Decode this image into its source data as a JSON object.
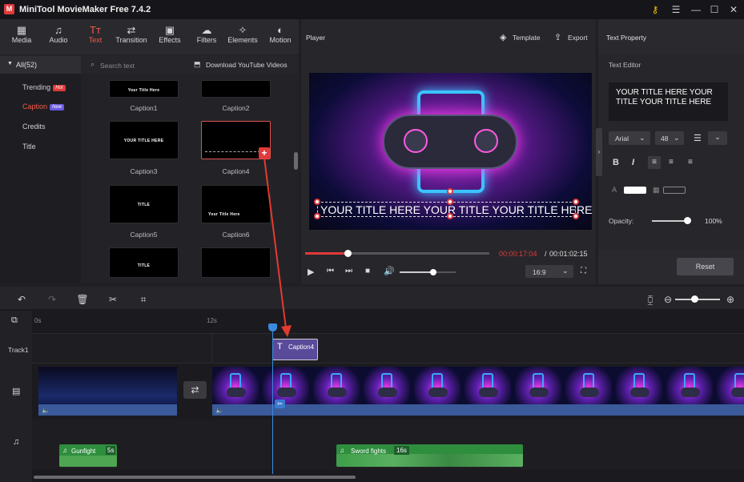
{
  "app": {
    "title": "MiniTool MovieMaker Free 7.4.2",
    "logo": "M"
  },
  "toolbar": {
    "items": [
      {
        "label": "Media",
        "icon": "media-icon"
      },
      {
        "label": "Audio",
        "icon": "audio-icon"
      },
      {
        "label": "Text",
        "icon": "text-icon"
      },
      {
        "label": "Transition",
        "icon": "transition-icon"
      },
      {
        "label": "Effects",
        "icon": "effects-icon"
      },
      {
        "label": "Filters",
        "icon": "filters-icon"
      },
      {
        "label": "Elements",
        "icon": "elements-icon"
      },
      {
        "label": "Motion",
        "icon": "motion-icon"
      }
    ],
    "active": "Text",
    "accent": "#f15a4a"
  },
  "library": {
    "all_label": "All(52)",
    "search_placeholder": "Search text",
    "download_label": "Download YouTube Videos",
    "categories": [
      {
        "label": "Trending",
        "badge": "Hot",
        "badge_color": "#e03a3a"
      },
      {
        "label": "Caption",
        "badge": "New",
        "badge_color": "#6a5ae0",
        "active": true
      },
      {
        "label": "Credits"
      },
      {
        "label": "Title"
      }
    ],
    "thumbs": [
      {
        "label": "Caption1",
        "text": "Your Title Here"
      },
      {
        "label": "Caption2",
        "text": ""
      },
      {
        "label": "Caption3",
        "text": "YOUR TITLE HERE"
      },
      {
        "label": "Caption4",
        "text": "",
        "selected": true
      },
      {
        "label": "Caption5",
        "text": "TITLE"
      },
      {
        "label": "Caption6",
        "text": "Your Title Here"
      },
      {
        "label": "",
        "text": "TITLE"
      },
      {
        "label": "",
        "text": ""
      }
    ]
  },
  "player": {
    "title": "Player",
    "template_label": "Template",
    "export_label": "Export",
    "overlay_text": "YOUR TITLE HERE YOUR TITLE YOUR TITLE HERE",
    "current_time": "00:00:17:04",
    "separator": "/",
    "total_time": "00:01:02:15",
    "aspect": "16:9",
    "progress": 0.23,
    "volume": 0.6
  },
  "properties": {
    "title": "Text Property",
    "editor_label": "Text Editor",
    "text": "YOUR  TITLE  HERE  YOUR TITLE YOUR TITLE HERE",
    "font": "Arial",
    "size": "48",
    "opacity_label": "Opacity:",
    "opacity_value": "100%",
    "opacity": 1.0,
    "reset_label": "Reset"
  },
  "timeline": {
    "ruler": [
      "0s",
      "12s"
    ],
    "track_label": "Track1",
    "text_clip": "Caption4",
    "audio": [
      {
        "name": "Gunfight",
        "duration": "5s"
      },
      {
        "name": "Sword fights",
        "duration": "16s"
      }
    ]
  }
}
